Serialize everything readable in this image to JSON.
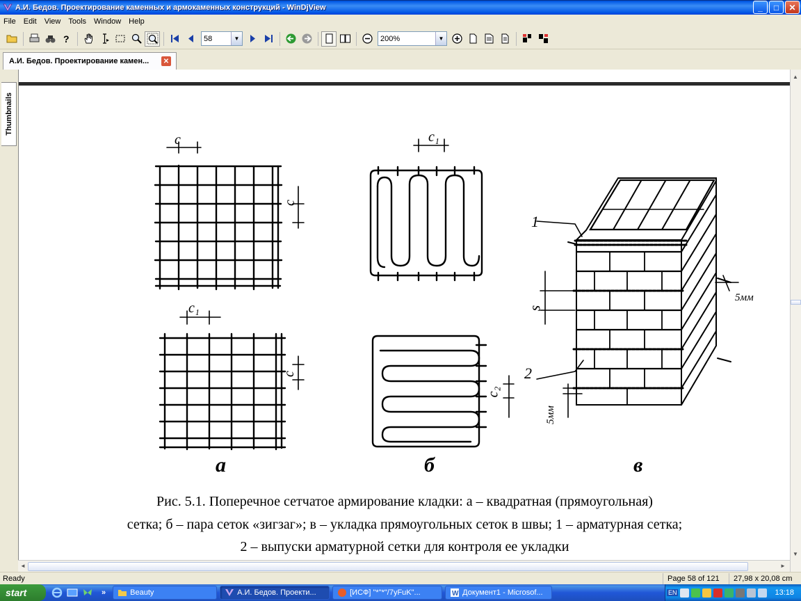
{
  "window": {
    "title": "А.И. Бедов. Проектирование каменных и армокаменных конструкций - WinDjView",
    "minimize": "_",
    "maximize": "□",
    "close": "✕"
  },
  "menu": [
    "File",
    "Edit",
    "View",
    "Tools",
    "Window",
    "Help"
  ],
  "toolbar": {
    "page_number": "58",
    "zoom": "200%"
  },
  "tab": {
    "title": "А.И. Бедов. Проектирование камен...",
    "close": "✕"
  },
  "sidebar": {
    "thumbnails_label": "Thumbnails"
  },
  "figure": {
    "label_a": "а",
    "label_b": "б",
    "label_v": "в",
    "dim_c": "c",
    "dim_c1": "c₁",
    "dim_c2": "c₂",
    "dim_s": "s",
    "dim_5mm": "5мм",
    "callout_1": "1",
    "callout_2": "2",
    "caption_line1": "Рис. 5.1. Поперечное сетчатое армирование кладки: а – квадратная (прямоугольная)",
    "caption_line2": "сетка; б – пара сеток «зигзаг»; в – укладка прямоугольных сеток в швы; 1 – арматурная сетка;",
    "caption_line3": "2 – выпуски арматурной сетки для контроля ее укладки"
  },
  "statusbar": {
    "status": "Ready",
    "page_info": "Page 58 of 121",
    "page_size": "27,98 x 20,08 cm"
  },
  "taskbar": {
    "start": "start",
    "quicklaunch_more": "»",
    "tasks": [
      "Beauty",
      "А.И. Бедов. Проекти...",
      "[ИСФ] \"*\"*\"/7yFuK\"...",
      "Документ1 - Microsof..."
    ],
    "tray_lang": "EN",
    "clock": "13:18"
  },
  "colors": {
    "titlebar": "#0055e5",
    "taskbar": "#2157d7",
    "tray": "#0f85e4"
  }
}
